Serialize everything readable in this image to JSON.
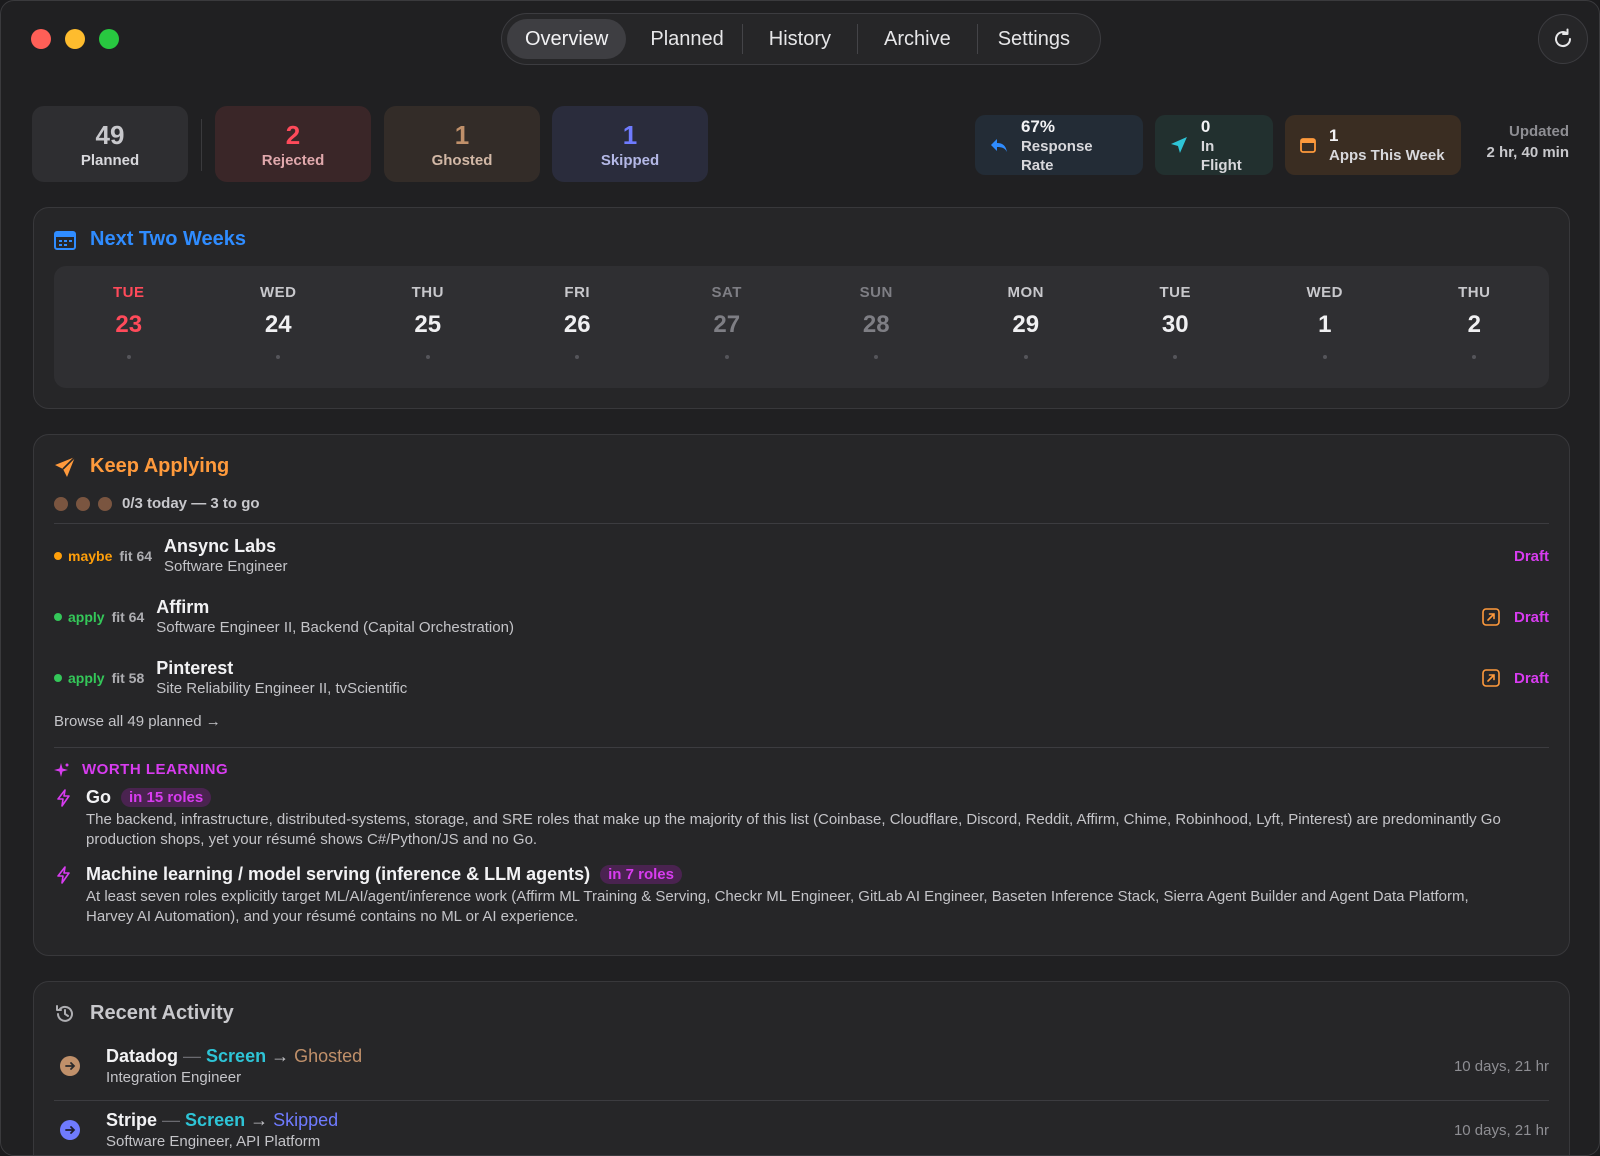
{
  "tabs": [
    "Overview",
    "Planned",
    "History",
    "Archive",
    "Settings"
  ],
  "stats": [
    {
      "value": "49",
      "label": "Planned"
    },
    {
      "value": "2",
      "label": "Rejected"
    },
    {
      "value": "1",
      "label": "Ghosted"
    },
    {
      "value": "1",
      "label": "Skipped"
    }
  ],
  "chips": [
    {
      "value": "67%",
      "label": "Response Rate"
    },
    {
      "value": "0",
      "label": "In Flight"
    },
    {
      "value": "1",
      "label": "Apps This Week"
    }
  ],
  "updated": {
    "label": "Updated",
    "value": "2 hr, 40 min"
  },
  "next_two_weeks": {
    "title": "Next Two Weeks",
    "days": [
      {
        "name": "TUE",
        "date": "23"
      },
      {
        "name": "WED",
        "date": "24"
      },
      {
        "name": "THU",
        "date": "25"
      },
      {
        "name": "FRI",
        "date": "26"
      },
      {
        "name": "SAT",
        "date": "27"
      },
      {
        "name": "SUN",
        "date": "28"
      },
      {
        "name": "MON",
        "date": "29"
      },
      {
        "name": "TUE",
        "date": "30"
      },
      {
        "name": "WED",
        "date": "1"
      },
      {
        "name": "THU",
        "date": "2"
      }
    ]
  },
  "keep_applying": {
    "title": "Keep Applying",
    "progress_text": "0/3 today — 3 to go",
    "jobs": [
      {
        "verdict": "maybe",
        "fit": "fit 64",
        "company": "Ansync Labs",
        "role": "Software Engineer",
        "action": "Draft"
      },
      {
        "verdict": "apply",
        "fit": "fit 64",
        "company": "Affirm",
        "role": "Software Engineer II, Backend (Capital Orchestration)",
        "action": "Draft"
      },
      {
        "verdict": "apply",
        "fit": "fit 58",
        "company": "Pinterest",
        "role": "Site Reliability Engineer II, tvScientific",
        "action": "Draft"
      }
    ],
    "browse_link": "Browse all 49 planned →",
    "worth_learning": {
      "title": "WORTH LEARNING",
      "items": [
        {
          "name": "Go",
          "badge": "in 15 roles",
          "desc": "The backend, infrastructure, distributed-systems, storage, and SRE roles that make up the majority of this list (Coinbase, Cloudflare, Discord, Reddit, Affirm, Chime, Robinhood, Lyft, Pinterest) are predominantly Go production shops, yet your résumé shows C#/Python/JS and no Go."
        },
        {
          "name": "Machine learning / model serving (inference & LLM agents)",
          "badge": "in 7 roles",
          "desc": "At least seven roles explicitly target ML/AI/agent/inference work (Affirm ML Training & Serving, Checkr ML Engineer, GitLab AI Engineer, Baseten Inference Stack, Sierra Agent Builder and Agent Data Platform, Harvey AI Automation), and your résumé contains no ML or AI experience."
        }
      ]
    }
  },
  "recent_activity": {
    "title": "Recent Activity",
    "items": [
      {
        "company": "Datadog",
        "from": "Screen",
        "to": "Ghosted",
        "role": "Integration Engineer",
        "time": "10 days, 21 hr"
      },
      {
        "company": "Stripe",
        "from": "Screen",
        "to": "Skipped",
        "role": "Software Engineer, API Platform",
        "time": "10 days, 21 hr"
      }
    ]
  },
  "colors": {
    "accent_blue": "#2f8cff",
    "keep_applying_orange": "#ff9a3c",
    "worth_learning_magenta": "#d83cf0",
    "rejected": "#ff4a5a",
    "ghosted": "#c0906a",
    "skipped": "#6f7bff",
    "screen": "#2ec4d6",
    "apply_green": "#34c759",
    "maybe_orange": "#ff9f0a"
  },
  "icons": {
    "refresh": "refresh-icon",
    "calendar": "calendar-icon",
    "paper_plane": "paper-plane-icon",
    "reply": "reply-arrow-icon",
    "external": "external-link-icon",
    "sparkle": "sparkle-icon",
    "bolt": "bolt-icon",
    "history": "history-clock-icon"
  }
}
